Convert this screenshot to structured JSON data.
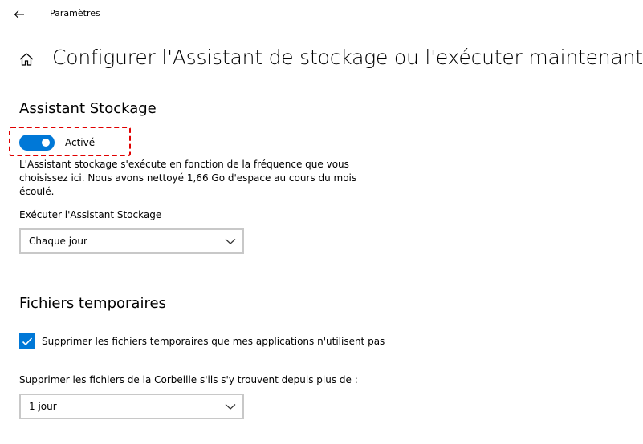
{
  "window": {
    "title": "Paramètres"
  },
  "page": {
    "title": "Configurer l'Assistant de stockage ou l'exécuter maintenant"
  },
  "storage_sense": {
    "section_title": "Assistant Stockage",
    "toggle_state": "Activé",
    "description": "L'Assistant stockage s'exécute en fonction de la fréquence que vous choisissez ici. Nous avons nettoyé 1,66 Go d'espace au cours du mois écoulé.",
    "run_label": "Exécuter l'Assistant Stockage",
    "run_selected": "Chaque jour"
  },
  "temp_files": {
    "section_title": "Fichiers temporaires",
    "delete_temp_label": "Supprimer les fichiers temporaires que mes applications n'utilisent pas",
    "recycle_label": "Supprimer les fichiers de la Corbeille s'ils s'y trouvent depuis plus de :",
    "recycle_selected": "1 jour"
  },
  "colors": {
    "accent": "#0078d7",
    "highlight": "#e00000"
  },
  "icons": {
    "back": "back-arrow-icon",
    "home": "home-icon",
    "chevron": "chevron-down-icon",
    "check": "checkmark-icon"
  }
}
